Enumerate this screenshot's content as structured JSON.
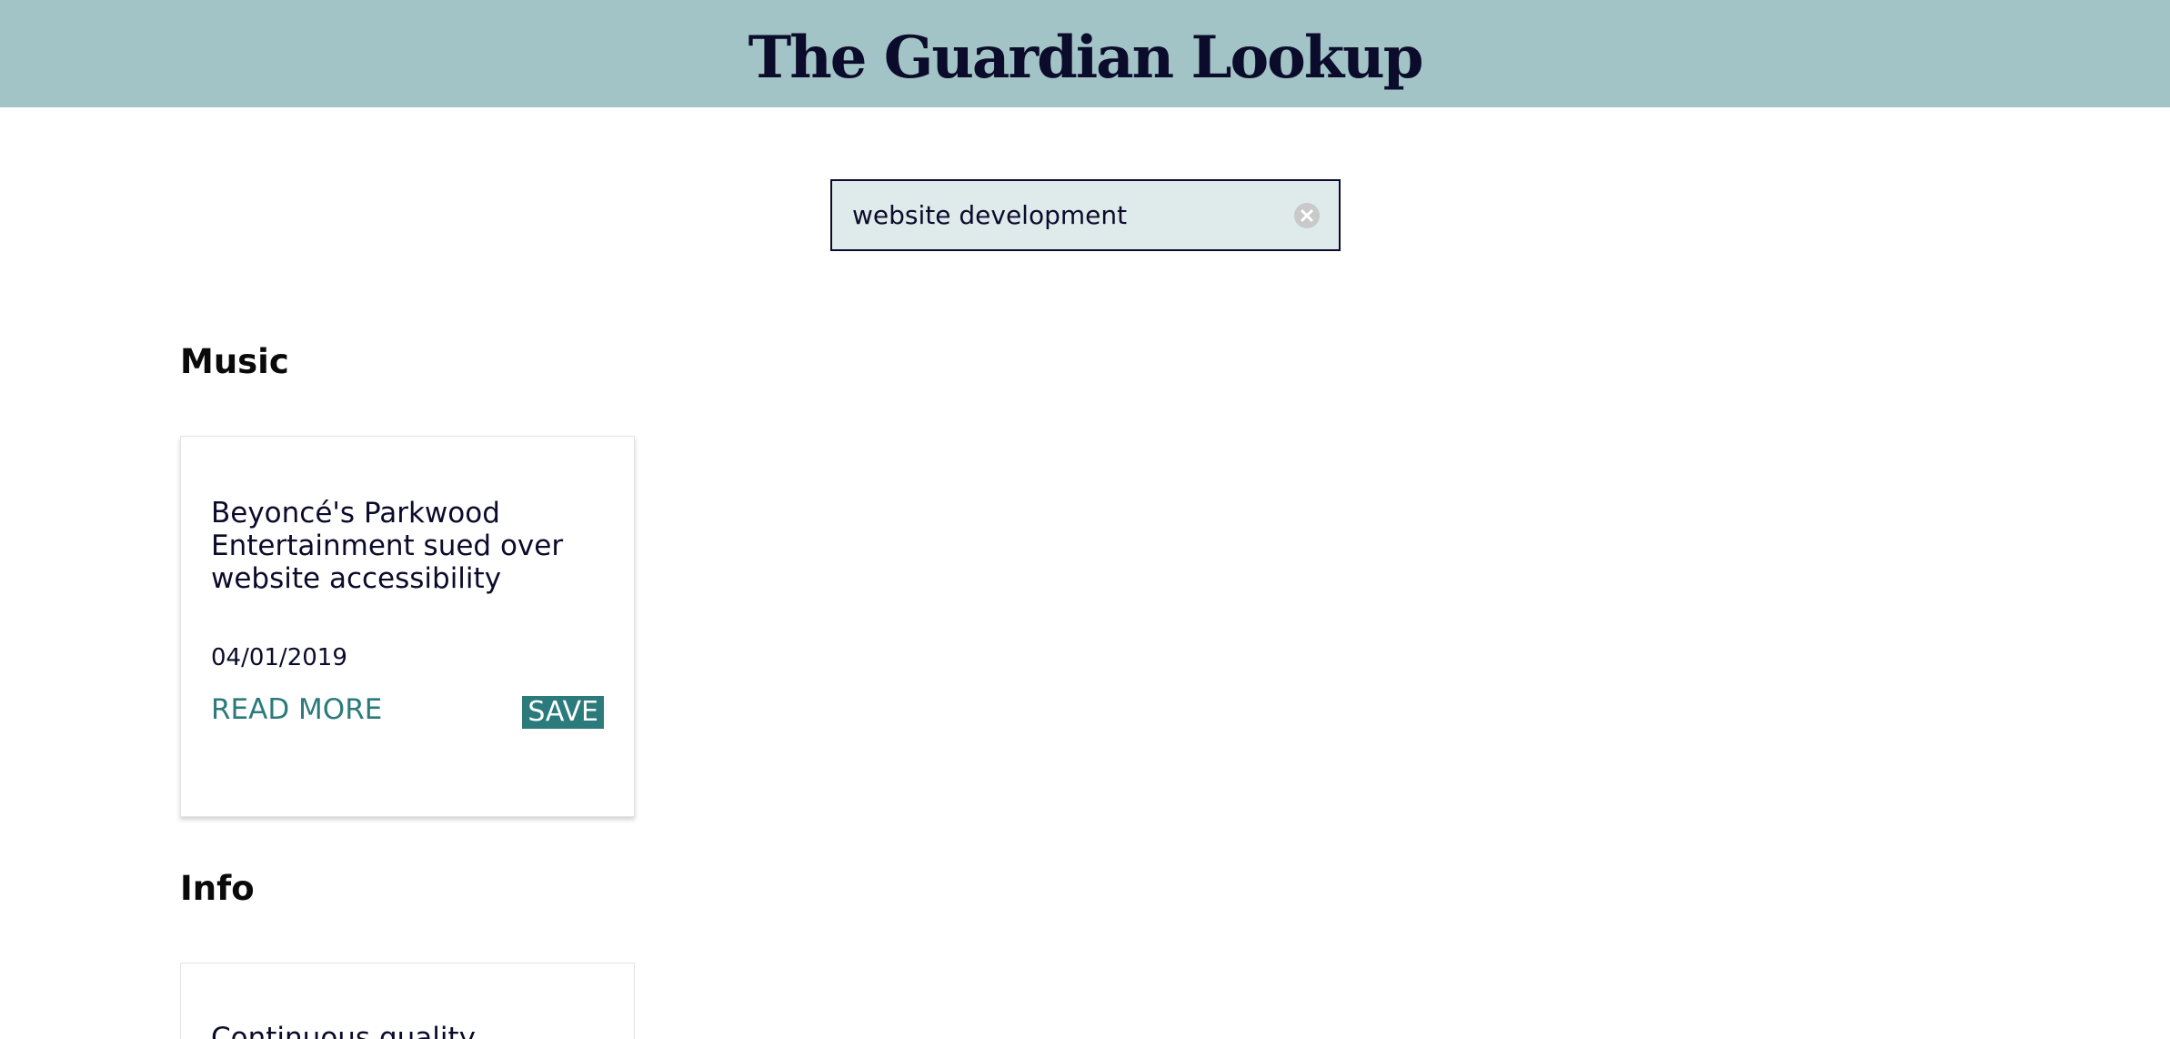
{
  "header": {
    "title": "The Guardian Lookup"
  },
  "search": {
    "value": "website development",
    "placeholder": "",
    "clear_icon": "clear-circle-icon"
  },
  "sections": [
    {
      "heading": "Music",
      "articles": [
        {
          "title": "Beyoncé's Parkwood Entertainment sued over website accessibility",
          "date": "04/01/2019",
          "read_more_label": "READ MORE",
          "save_label": "SAVE"
        }
      ]
    },
    {
      "heading": "Info",
      "articles": [
        {
          "title": "Continuous quality"
        }
      ]
    }
  ],
  "colors": {
    "header_bg": "#a3c4c6",
    "accent": "#2b7a7c",
    "text_dark": "#0b0b2b",
    "search_bg": "#dfeaea"
  }
}
